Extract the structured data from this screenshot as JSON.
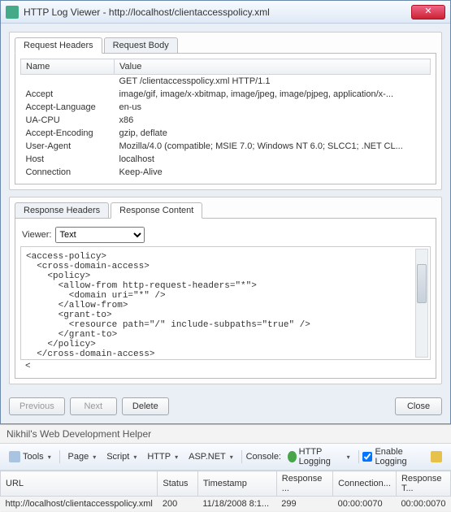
{
  "window": {
    "title": "HTTP Log Viewer - http://localhost/clientaccesspolicy.xml",
    "close_glyph": "✕"
  },
  "req_tabs": {
    "headers": "Request Headers",
    "body": "Request Body"
  },
  "req_table": {
    "col_name": "Name",
    "col_value": "Value",
    "rows": [
      {
        "name": "",
        "value": "GET /clientaccesspolicy.xml HTTP/1.1"
      },
      {
        "name": "Accept",
        "value": "image/gif, image/x-xbitmap, image/jpeg, image/pjpeg, application/x-..."
      },
      {
        "name": "Accept-Language",
        "value": "en-us"
      },
      {
        "name": "UA-CPU",
        "value": "x86"
      },
      {
        "name": "Accept-Encoding",
        "value": "gzip, deflate"
      },
      {
        "name": "User-Agent",
        "value": "Mozilla/4.0 (compatible; MSIE 7.0; Windows NT 6.0; SLCC1; .NET CL..."
      },
      {
        "name": "Host",
        "value": "localhost"
      },
      {
        "name": "Connection",
        "value": "Keep-Alive"
      }
    ]
  },
  "resp_tabs": {
    "headers": "Response Headers",
    "content": "Response Content"
  },
  "viewer": {
    "label": "Viewer:",
    "selected": "Text"
  },
  "response_content": "<access-policy>\n  <cross-domain-access>\n    <policy>\n      <allow-from http-request-headers=\"*\">\n        <domain uri=\"*\" />\n      </allow-from>\n      <grant-to>\n        <resource path=\"/\" include-subpaths=\"true\" />\n      </grant-to>\n    </policy>\n  </cross-domain-access>\n",
  "buttons": {
    "previous": "Previous",
    "next": "Next",
    "delete": "Delete",
    "close": "Close"
  },
  "helper": {
    "title": "Nikhil's Web Development Helper",
    "tools": "Tools",
    "page": "Page",
    "script": "Script",
    "http": "HTTP",
    "aspnet": "ASP.NET",
    "console_label": "Console:",
    "http_logging": "HTTP Logging",
    "enable_logging": "Enable Logging"
  },
  "grid": {
    "cols": {
      "url": "URL",
      "status": "Status",
      "timestamp": "Timestamp",
      "response": "Response ...",
      "connection": "Connection...",
      "responset": "Response T..."
    },
    "rows": [
      {
        "url": "http://localhost/clientaccesspolicy.xml",
        "status": "200",
        "timestamp": "11/18/2008 8:1...",
        "response": "299",
        "connection": "00:00:0070",
        "responset": "00:00:0070"
      }
    ]
  }
}
